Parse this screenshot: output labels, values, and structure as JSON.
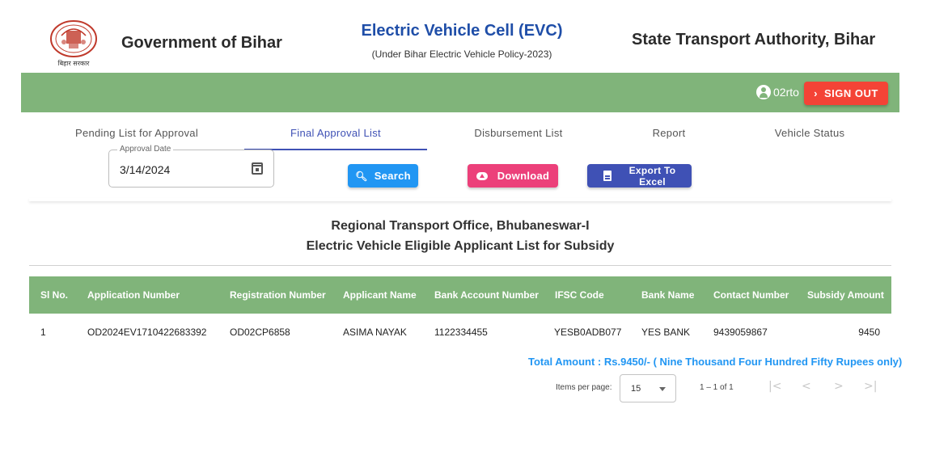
{
  "header": {
    "logo_caption": "बिहार सरकार",
    "gov_title": "Government of Bihar",
    "evc_title": "Electric Vehicle Cell (EVC)",
    "evc_subtitle": "(Under Bihar Electric Vehicle Policy-2023)",
    "authority_title": "State Transport Authority, Bihar"
  },
  "topbar": {
    "user_icon": "account-circle-icon",
    "username": "02rto",
    "signout_icon": "chevron-right-icon",
    "signout_label": "SIGN OUT"
  },
  "tabs": [
    {
      "label": "Pending List for Approval",
      "active": false
    },
    {
      "label": "Final Approval List",
      "active": true
    },
    {
      "label": "Disbursement List",
      "active": false
    },
    {
      "label": "Report",
      "active": false
    },
    {
      "label": "Vehicle Status",
      "active": false
    }
  ],
  "filters": {
    "date_label": "Approval Date",
    "date_value": "3/14/2024",
    "calendar_icon": "calendar-icon",
    "search_label": "Search",
    "search_icon": "search-icon",
    "download_label": "Download",
    "download_icon": "cloud-upload-icon",
    "export_line1": "Export To",
    "export_line2": "Excel",
    "export_icon": "document-icon"
  },
  "report": {
    "office_title": "Regional Transport Office, Bhubaneswar-I",
    "list_title": "Electric Vehicle Eligible Applicant List for Subsidy"
  },
  "table": {
    "headers": [
      "Sl No.",
      "Application Number",
      "Registration Number",
      "Applicant Name",
      "Bank Account Number",
      "IFSC Code",
      "Bank Name",
      "Contact Number",
      "Subsidy Amount"
    ],
    "rows": [
      [
        "1",
        "OD2024EV1710422683392",
        "OD02CP6858",
        "ASIMA NAYAK",
        "1122334455",
        "YESB0ADB077",
        "YES BANK",
        "9439059867",
        "9450"
      ]
    ]
  },
  "total_amount": "Total Amount : Rs.9450/- ( Nine Thousand Four Hundred Fifty Rupees only)",
  "paginator": {
    "items_per_page_label": "Items per page:",
    "page_size": "15",
    "range_label": "1 – 1 of 1",
    "first_icon": "first-page-icon",
    "prev_icon": "chevron-left-icon",
    "next_icon": "chevron-right-icon",
    "last_icon": "last-page-icon"
  },
  "colors": {
    "green_bar": "#80b47a",
    "signout": "#f44336",
    "search": "#2196f3",
    "download": "#ec407a",
    "export": "#3f51b5",
    "title_blue": "#1f4ea8"
  }
}
